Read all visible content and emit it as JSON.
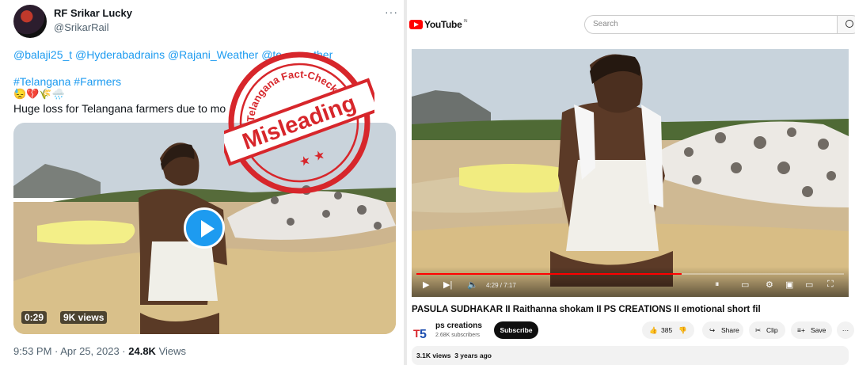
{
  "tweet": {
    "display_name": "RF Srikar Lucky",
    "handle": "@SrikarRail",
    "more": "···",
    "mentions": "@balaji25_t @Hyderabadrains @Rajani_Weather @te",
    "mentions_tail": "ther",
    "hashtags": "#Telangana #Farmers",
    "emojis": "😓💔🌾🌧️",
    "text": "Huge loss for Telangana farmers due to mo",
    "video_duration": "0:29",
    "video_views": "9K views",
    "time": "9:53 PM · Apr 25, 2023 · ",
    "views_count": "24.8K",
    "views_label": " Views"
  },
  "stamp": {
    "arc_text": "Telangana Fact-Check",
    "label": "Misleading",
    "stars": "★ ★"
  },
  "youtube": {
    "logo_text": "YouTube",
    "region": "IN",
    "search_placeholder": "Search",
    "time_current": "4:29",
    "time_total": "7:17",
    "progress": 0.62,
    "title": "PASULA SUDHAKAR II Raithanna shokam II PS CREATIONS II emotional short fil",
    "channel": "ps creations",
    "subscribers": "2.68K subscribers",
    "subscribe_label": "Subscribe",
    "likes": "385",
    "share_label": "Share",
    "clip_label": "Clip",
    "save_label": "Save",
    "more": "···",
    "views": "3.1K views",
    "age": "3 years ago",
    "brand_red": "#ff0000"
  }
}
